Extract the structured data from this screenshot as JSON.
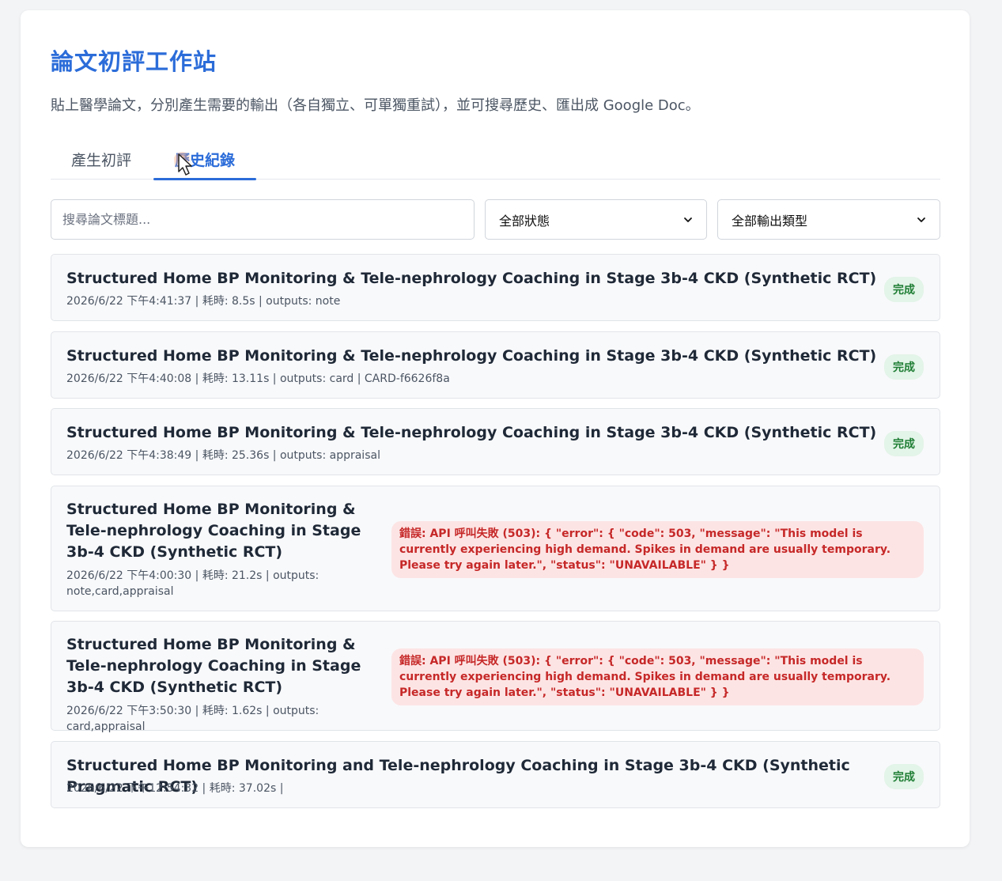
{
  "header": {
    "title": "論文初評工作站",
    "subtitle": "貼上醫學論文，分別產生需要的輸出（各自獨立、可單獨重試），並可搜尋歷史、匯出成 Google Doc。"
  },
  "tabs": [
    {
      "label": "產生初評"
    },
    {
      "label": "歷史紀錄"
    }
  ],
  "filters": {
    "search_placeholder": "搜尋論文標題...",
    "status_selected": "全部狀態",
    "type_selected": "全部輸出類型"
  },
  "history": [
    {
      "title": "Structured Home BP Monitoring & Tele-nephrology Coaching in Stage 3b-4 CKD (Synthetic RCT)",
      "meta": "2026/6/22 下午4:41:37 | 耗時: 8.5s | outputs: note",
      "status": "完成"
    },
    {
      "title": "Structured Home BP Monitoring & Tele-nephrology Coaching in Stage 3b-4 CKD (Synthetic RCT)",
      "meta": "2026/6/22 下午4:40:08 | 耗時: 13.11s | outputs: card | CARD-f6626f8a",
      "status": "完成"
    },
    {
      "title": "Structured Home BP Monitoring & Tele-nephrology Coaching in Stage 3b-4 CKD (Synthetic RCT)",
      "meta": "2026/6/22 下午4:38:49 | 耗時: 25.36s | outputs: appraisal",
      "status": "完成"
    },
    {
      "title": "Structured Home BP Monitoring & Tele-nephrology Coaching in Stage 3b-4 CKD (Synthetic RCT)",
      "meta": "2026/6/22 下午4:00:30 | 耗時: 21.2s | outputs: note,card,appraisal",
      "error": "錯誤: API 呼叫失敗 (503): { \"error\": { \"code\": 503, \"message\": \"This model is currently experiencing high demand. Spikes in demand are usually temporary. Please try again later.\", \"status\": \"UNAVAILABLE\" } }"
    },
    {
      "title": "Structured Home BP Monitoring & Tele-nephrology Coaching in Stage 3b-4 CKD (Synthetic RCT)",
      "meta": "2026/6/22 下午3:50:30 | 耗時: 1.62s | outputs: card,appraisal",
      "error": "錯誤: API 呼叫失敗 (503): { \"error\": { \"code\": 503, \"message\": \"This model is currently experiencing high demand. Spikes in demand are usually temporary. Please try again later.\", \"status\": \"UNAVAILABLE\" } }"
    },
    {
      "title": "Structured Home BP Monitoring and Tele-nephrology Coaching in Stage 3b-4 CKD (Synthetic Pragmatic RCT)",
      "meta": "2026/6/22 下午12:54:32 | 耗時: 37.02s |",
      "status": "完成"
    }
  ],
  "icons": {
    "cursor": "pointer-cursor-icon",
    "dropdown": "chevron-down-icon"
  },
  "colors": {
    "accent": "#2b6cd9",
    "success_bg": "#e3f4e8",
    "success_text": "#1e7e34",
    "error_bg": "#fde4e4",
    "error_text": "#c62828"
  }
}
